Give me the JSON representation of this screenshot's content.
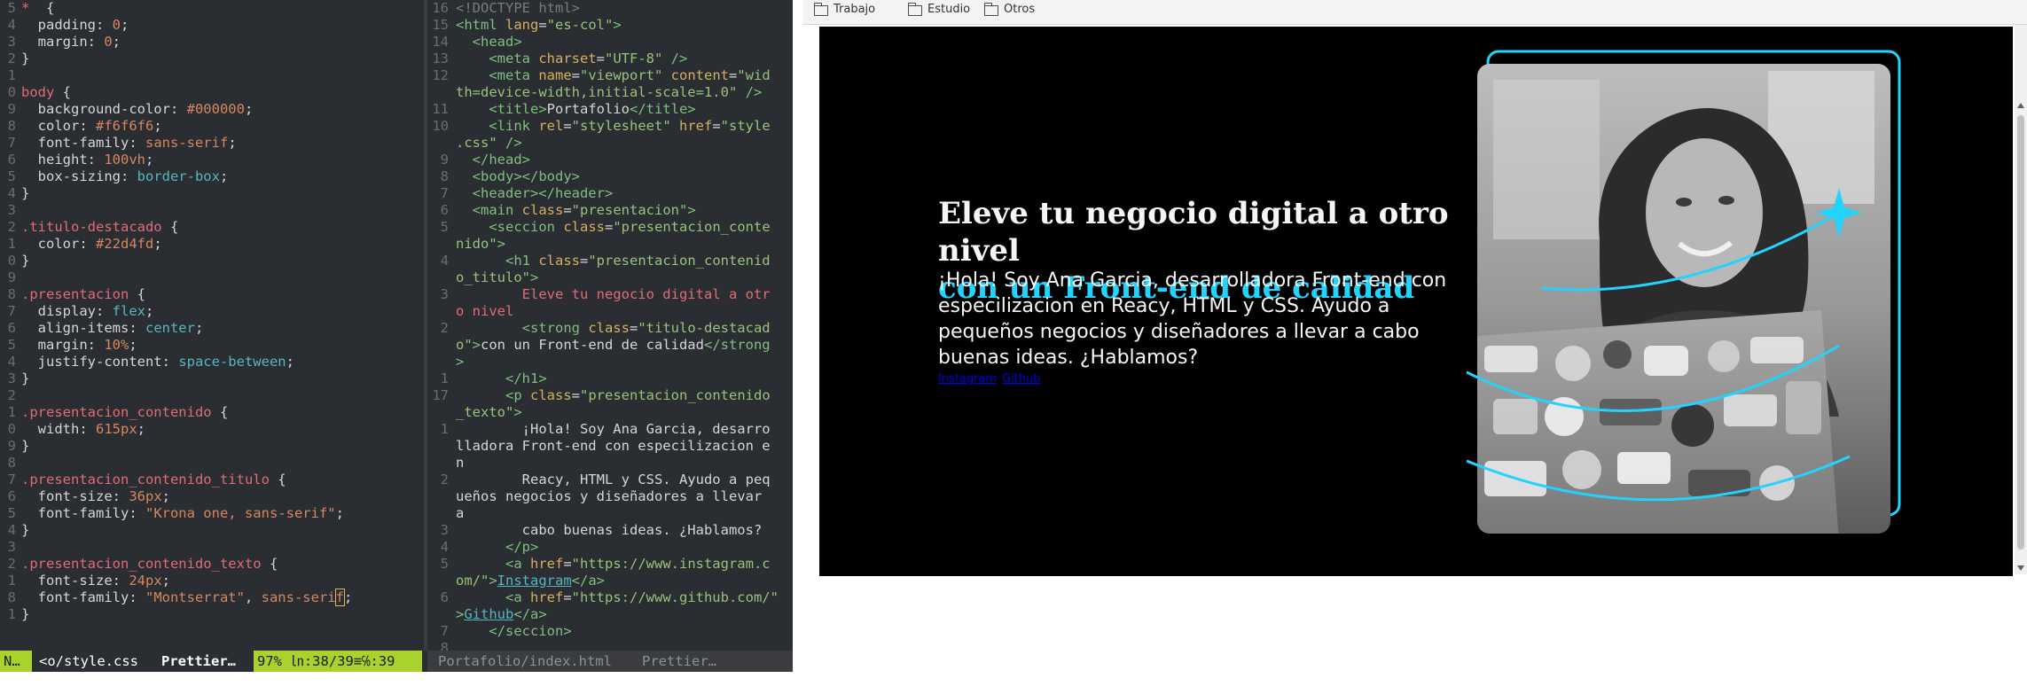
{
  "editor_css": {
    "lines": [
      {
        "n": "5",
        "parts": [
          [
            "c-sel",
            "*"
          ],
          [
            "",
            "  {"
          ]
        ]
      },
      {
        "n": "4",
        "parts": [
          [
            "",
            "  padding: "
          ],
          [
            "c-val",
            "0"
          ],
          [
            "",
            ";"
          ]
        ]
      },
      {
        "n": "3",
        "parts": [
          [
            "",
            "  margin: "
          ],
          [
            "c-val",
            "0"
          ],
          [
            "",
            ";"
          ]
        ]
      },
      {
        "n": "2",
        "parts": [
          [
            "",
            "}"
          ]
        ]
      },
      {
        "n": "1",
        "parts": [
          [
            "",
            ""
          ]
        ]
      },
      {
        "n": "0",
        "parts": [
          [
            "c-sel",
            "body"
          ],
          [
            "",
            " {"
          ]
        ]
      },
      {
        "n": "9",
        "parts": [
          [
            "",
            "  background-color: "
          ],
          [
            "c-val",
            "#000000"
          ],
          [
            "",
            ";"
          ]
        ]
      },
      {
        "n": "8",
        "parts": [
          [
            "",
            "  color: "
          ],
          [
            "c-val",
            "#f6f6f6"
          ],
          [
            "",
            ";"
          ]
        ]
      },
      {
        "n": "7",
        "parts": [
          [
            "",
            "  font-family: "
          ],
          [
            "c-val",
            "sans-serif"
          ],
          [
            "",
            ";"
          ]
        ]
      },
      {
        "n": "6",
        "parts": [
          [
            "",
            "  height: "
          ],
          [
            "c-val",
            "100vh"
          ],
          [
            "",
            ";"
          ]
        ]
      },
      {
        "n": "5",
        "parts": [
          [
            "",
            "  box-sizing: "
          ],
          [
            "c-kw",
            "border-box"
          ],
          [
            "",
            ";"
          ]
        ]
      },
      {
        "n": "4",
        "parts": [
          [
            "",
            "}"
          ]
        ]
      },
      {
        "n": "3",
        "parts": [
          [
            "",
            ""
          ]
        ]
      },
      {
        "n": "2",
        "parts": [
          [
            "c-sel",
            ".titulo-destacado"
          ],
          [
            "",
            " {"
          ]
        ]
      },
      {
        "n": "1",
        "parts": [
          [
            "",
            "  color: "
          ],
          [
            "c-val",
            "#22d4fd"
          ],
          [
            "",
            ";"
          ]
        ]
      },
      {
        "n": "0",
        "parts": [
          [
            "",
            "}"
          ]
        ]
      },
      {
        "n": "9",
        "parts": [
          [
            "",
            ""
          ]
        ]
      },
      {
        "n": "8",
        "parts": [
          [
            "c-sel",
            ".presentacion"
          ],
          [
            "",
            " {"
          ]
        ]
      },
      {
        "n": "7",
        "parts": [
          [
            "",
            "  display: "
          ],
          [
            "c-kw",
            "flex"
          ],
          [
            "",
            ";"
          ]
        ]
      },
      {
        "n": "6",
        "parts": [
          [
            "",
            "  align-items: "
          ],
          [
            "c-kw",
            "center"
          ],
          [
            "",
            ";"
          ]
        ]
      },
      {
        "n": "5",
        "parts": [
          [
            "",
            "  margin: "
          ],
          [
            "c-val",
            "10%"
          ],
          [
            "",
            ";"
          ]
        ]
      },
      {
        "n": "4",
        "parts": [
          [
            "",
            "  justify-content: "
          ],
          [
            "c-kw",
            "space-between"
          ],
          [
            "",
            ";"
          ]
        ]
      },
      {
        "n": "3",
        "parts": [
          [
            "",
            "}"
          ]
        ]
      },
      {
        "n": "2",
        "parts": [
          [
            "",
            ""
          ]
        ]
      },
      {
        "n": "1",
        "parts": [
          [
            "c-sel",
            ".presentacion_contenido"
          ],
          [
            "",
            " {"
          ]
        ]
      },
      {
        "n": "0",
        "parts": [
          [
            "",
            "  width: "
          ],
          [
            "c-val",
            "615px"
          ],
          [
            "",
            ";"
          ]
        ]
      },
      {
        "n": "9",
        "parts": [
          [
            "",
            "}"
          ]
        ]
      },
      {
        "n": "8",
        "parts": [
          [
            "",
            ""
          ]
        ]
      },
      {
        "n": "7",
        "parts": [
          [
            "c-sel",
            ".presentacion_contenido_titulo"
          ],
          [
            "",
            " {"
          ]
        ]
      },
      {
        "n": "6",
        "parts": [
          [
            "",
            "  font-size: "
          ],
          [
            "c-val",
            "36px"
          ],
          [
            "",
            ";"
          ]
        ]
      },
      {
        "n": "5",
        "parts": [
          [
            "",
            "  font-family: "
          ],
          [
            "c-val",
            "\"Krona one, sans-serif\""
          ],
          [
            "",
            ";"
          ]
        ]
      },
      {
        "n": "4",
        "parts": [
          [
            "",
            "}"
          ]
        ]
      },
      {
        "n": "3",
        "parts": [
          [
            "",
            ""
          ]
        ]
      },
      {
        "n": "2",
        "parts": [
          [
            "c-sel",
            ".presentacion_contenido_texto"
          ],
          [
            "",
            " {"
          ]
        ]
      },
      {
        "n": "1",
        "parts": [
          [
            "",
            "  font-size: "
          ],
          [
            "c-val",
            "24px"
          ],
          [
            "",
            ";"
          ]
        ]
      },
      {
        "n": "8",
        "parts": [
          [
            "",
            "  font-family: "
          ],
          [
            "c-val",
            "\"Montserrat\""
          ],
          [
            "",
            ", "
          ],
          [
            "c-val",
            "sans-seri"
          ],
          [
            "c-val cursor-box",
            "f"
          ],
          [
            "",
            ";"
          ]
        ]
      },
      {
        "n": "1",
        "parts": [
          [
            "",
            "}"
          ]
        ]
      }
    ]
  },
  "editor_html": {
    "lines": [
      {
        "n": "16",
        "parts": [
          [
            "c-dim",
            "<!DOCTYPE html>"
          ]
        ]
      },
      {
        "n": "15",
        "parts": [
          [
            "c-tag",
            "<html "
          ],
          [
            "c-attr",
            "lang"
          ],
          [
            "",
            "="
          ],
          [
            "c-str",
            "\"es-col\""
          ],
          [
            "c-tag",
            ">"
          ]
        ]
      },
      {
        "n": "14",
        "parts": [
          [
            "c-tag",
            "  <head>"
          ]
        ]
      },
      {
        "n": "13",
        "parts": [
          [
            "c-tag",
            "    <meta "
          ],
          [
            "c-attr",
            "charset"
          ],
          [
            "",
            "="
          ],
          [
            "c-str",
            "\"UTF-8\""
          ],
          [
            "c-tag",
            " />"
          ]
        ]
      },
      {
        "n": "12",
        "parts": [
          [
            "c-tag",
            "    <meta "
          ],
          [
            "c-attr",
            "name"
          ],
          [
            "",
            "="
          ],
          [
            "c-str",
            "\"viewport\""
          ],
          [
            "c-attr",
            " content"
          ],
          [
            "",
            "="
          ],
          [
            "c-str",
            "\"wid"
          ]
        ]
      },
      {
        "n": "",
        "parts": [
          [
            "c-str",
            "th=device-width,initial-scale=1.0\""
          ],
          [
            "c-tag",
            " />"
          ]
        ]
      },
      {
        "n": "11",
        "parts": [
          [
            "c-tag",
            "    <title>"
          ],
          [
            "",
            "Portafolio"
          ],
          [
            "c-tag",
            "</title>"
          ]
        ]
      },
      {
        "n": "10",
        "parts": [
          [
            "c-tag",
            "    <link "
          ],
          [
            "c-attr",
            "rel"
          ],
          [
            "",
            "="
          ],
          [
            "c-str",
            "\"stylesheet\""
          ],
          [
            "c-attr",
            " href"
          ],
          [
            "",
            "="
          ],
          [
            "c-str",
            "\"style"
          ]
        ]
      },
      {
        "n": "",
        "parts": [
          [
            "c-str",
            ".css\""
          ],
          [
            "c-tag",
            " />"
          ]
        ]
      },
      {
        "n": "9",
        "parts": [
          [
            "c-tag",
            "  </head>"
          ]
        ]
      },
      {
        "n": "8",
        "parts": [
          [
            "c-tag",
            "  <body></body>"
          ]
        ]
      },
      {
        "n": "7",
        "parts": [
          [
            "c-tag",
            "  <header></header>"
          ]
        ]
      },
      {
        "n": "6",
        "parts": [
          [
            "c-tag",
            "  <main "
          ],
          [
            "c-attr",
            "class"
          ],
          [
            "",
            "="
          ],
          [
            "c-str",
            "\"presentacion\""
          ],
          [
            "c-tag",
            ">"
          ]
        ]
      },
      {
        "n": "5",
        "parts": [
          [
            "c-tag",
            "    <seccion "
          ],
          [
            "c-attr",
            "class"
          ],
          [
            "",
            "="
          ],
          [
            "c-str",
            "\"presentacion_conte"
          ]
        ]
      },
      {
        "n": "",
        "parts": [
          [
            "c-str",
            "nido\""
          ],
          [
            "c-tag",
            ">"
          ]
        ]
      },
      {
        "n": "4",
        "parts": [
          [
            "c-tag",
            "      <h1 "
          ],
          [
            "c-attr",
            "class"
          ],
          [
            "",
            "="
          ],
          [
            "c-str",
            "\"presentacion_contenid"
          ]
        ]
      },
      {
        "n": "",
        "parts": [
          [
            "c-str",
            "o_titulo\""
          ],
          [
            "c-tag",
            ">"
          ]
        ]
      },
      {
        "n": "3",
        "parts": [
          [
            "c-txt",
            "        Eleve tu negocio digital a otr"
          ]
        ]
      },
      {
        "n": "",
        "parts": [
          [
            "c-txt",
            "o nivel"
          ]
        ]
      },
      {
        "n": "2",
        "parts": [
          [
            "c-tag",
            "        <strong "
          ],
          [
            "c-attr",
            "class"
          ],
          [
            "",
            "="
          ],
          [
            "c-str",
            "\"titulo-destacad"
          ]
        ]
      },
      {
        "n": "",
        "parts": [
          [
            "c-str",
            "o\""
          ],
          [
            "c-tag",
            ">"
          ],
          [
            "",
            "con un Front-end de calidad"
          ],
          [
            "c-tag",
            "</strong"
          ]
        ]
      },
      {
        "n": "",
        "parts": [
          [
            "c-tag",
            ">"
          ]
        ]
      },
      {
        "n": "1",
        "parts": [
          [
            "c-tag",
            "      </h1>"
          ]
        ]
      },
      {
        "n": "17",
        "parts": [
          [
            "c-tag",
            "      <p "
          ],
          [
            "c-attr",
            "class"
          ],
          [
            "",
            "="
          ],
          [
            "c-str",
            "\"presentacion_contenido"
          ]
        ]
      },
      {
        "n": "",
        "parts": [
          [
            "c-str",
            "_texto\""
          ],
          [
            "c-tag",
            ">"
          ]
        ]
      },
      {
        "n": "1",
        "parts": [
          [
            "",
            "        ¡Hola! Soy Ana Garcia, desarro"
          ]
        ]
      },
      {
        "n": "",
        "parts": [
          [
            "",
            "lladora Front-end con especilizacion e"
          ]
        ]
      },
      {
        "n": "",
        "parts": [
          [
            "",
            "n"
          ]
        ]
      },
      {
        "n": "2",
        "parts": [
          [
            "",
            "        Reacy, HTML y CSS. Ayudo a peq"
          ]
        ]
      },
      {
        "n": "",
        "parts": [
          [
            "",
            "ueños negocios y diseñadores a llevar"
          ]
        ]
      },
      {
        "n": "",
        "parts": [
          [
            "",
            "a"
          ]
        ]
      },
      {
        "n": "3",
        "parts": [
          [
            "",
            "        cabo buenas ideas. ¿Hablamos?"
          ]
        ]
      },
      {
        "n": "4",
        "parts": [
          [
            "c-tag",
            "      </p>"
          ]
        ]
      },
      {
        "n": "5",
        "parts": [
          [
            "c-tag",
            "      <a "
          ],
          [
            "c-attr",
            "href"
          ],
          [
            "",
            "="
          ],
          [
            "c-str",
            "\"https://www.instagram.c"
          ]
        ]
      },
      {
        "n": "",
        "parts": [
          [
            "c-str",
            "om/\""
          ],
          [
            "c-tag",
            ">"
          ],
          [
            "c-link",
            "Instagram"
          ],
          [
            "c-tag",
            "</a>"
          ]
        ]
      },
      {
        "n": "6",
        "parts": [
          [
            "c-tag",
            "      <a "
          ],
          [
            "c-attr",
            "href"
          ],
          [
            "",
            "="
          ],
          [
            "c-str",
            "\"https://www.github.com/\""
          ]
        ]
      },
      {
        "n": "",
        "parts": [
          [
            "c-tag",
            ">"
          ],
          [
            "c-link",
            "Github"
          ],
          [
            "c-tag",
            "</a>"
          ]
        ]
      },
      {
        "n": "7",
        "parts": [
          [
            "c-tag",
            "    </seccion>"
          ]
        ]
      },
      {
        "n": "8",
        "parts": [
          [
            "",
            ""
          ]
        ]
      }
    ]
  },
  "status_bar": {
    "mode": "N…",
    "file": "<o/style.css",
    "plugin": "Prettier…",
    "position": "97% ㏑:38/39≡℅:39",
    "right_file": "Portafolio/index.html",
    "right_plugin": "Prettier…"
  },
  "bookmarks": [
    {
      "label": "Trabajo",
      "icon": "folder-icon"
    },
    {
      "label": "Estudio",
      "icon": "folder-icon"
    },
    {
      "label": "Otros",
      "icon": "folder-icon"
    }
  ],
  "page": {
    "title_main": "Eleve tu negocio digital a otro nivel",
    "title_highlight": "con un Front-end de calidad",
    "text": "¡Hola! Soy Ana Garcia, desarrolladora Front-end con especilizacion en Reacy, HTML y CSS. Ayudo a pequeños negocios y diseñadores a llevar a cabo buenas ideas. ¿Hablamos?",
    "link_instagram": "Instagram",
    "link_github": "Github",
    "accent_color": "#22d4fd",
    "background_color": "#000000",
    "text_color": "#f6f6f6"
  }
}
